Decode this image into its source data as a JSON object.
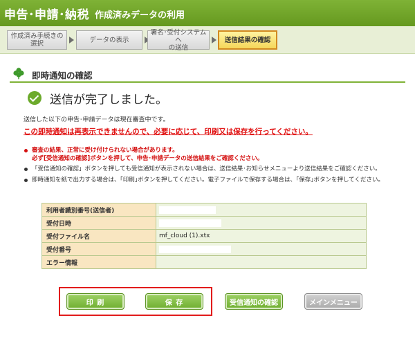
{
  "header": {
    "main_title": "申告･申請･納税",
    "sub_title": "作成済みデータの利用"
  },
  "steps": [
    {
      "label": "作成済み手続きの\n選択"
    },
    {
      "label": "データの表示"
    },
    {
      "label": "署名･受付システムへ\nの送信"
    },
    {
      "label": "送信結果の確認"
    }
  ],
  "section": {
    "title": "即時通知の確認"
  },
  "status": {
    "done_text": "送信が完了しました。"
  },
  "messages": {
    "info": "送信した以下の申告･申請データは現在審査中です。",
    "warning": "この即時通知は再表示できませんので、必要に応じて、印刷又は保存を行ってください。"
  },
  "notes": [
    "審査の結果、正常に受け付けられない場合があります。\n必ず[受信通知の確認]ボタンを押して、申告･申請データの送信結果をご確認ください。",
    "「受信通知の確認」ボタンを押しても受信通知が表示されない場合は、送信結果･お知らせメニューより送信結果をご確認ください。",
    "即時通知を紙で出力する場合は、｢印刷｣ボタンを押してください。電子ファイルで保存する場合は、｢保存｣ボタンを押してください。"
  ],
  "info_table": [
    {
      "label": "利用者識別番号(送信者)",
      "value": ""
    },
    {
      "label": "受付日時",
      "value": ""
    },
    {
      "label": "受付ファイル名",
      "value": "mf_cloud (1).xtx"
    },
    {
      "label": "受付番号",
      "value": ""
    },
    {
      "label": "エラー情報",
      "value": ""
    }
  ],
  "buttons": {
    "print": "印 刷",
    "save": "保 存",
    "receipt": "受信通知の確認",
    "main_menu": "メインメニュー"
  }
}
